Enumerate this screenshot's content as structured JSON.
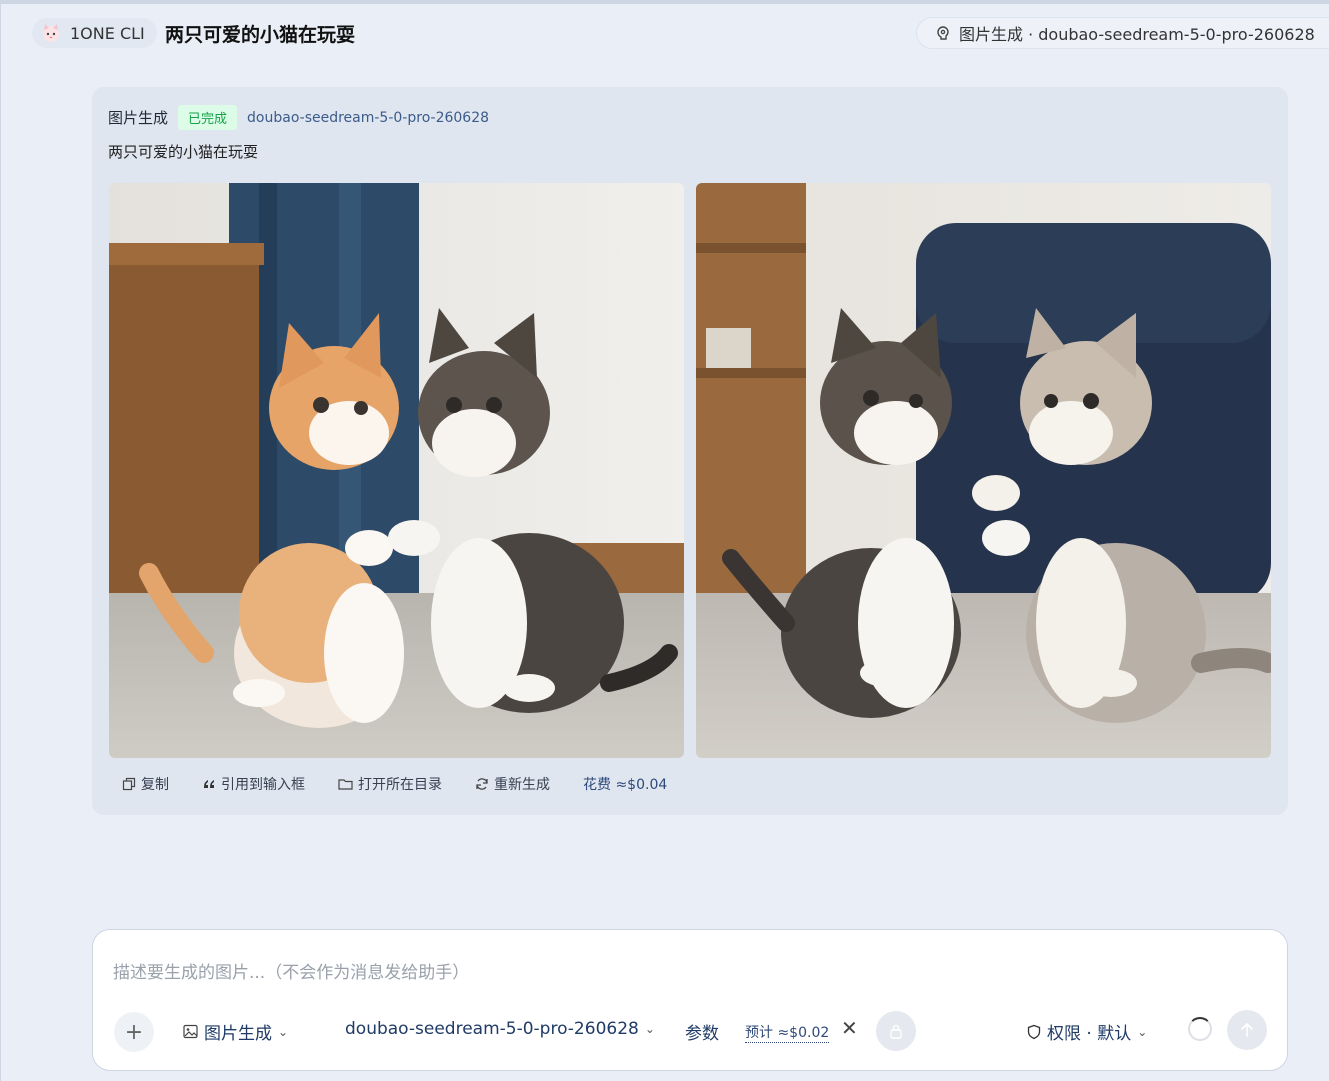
{
  "header": {
    "app_name": "1ONE CLI",
    "conversation_title": "两只可爱的小猫在玩耍",
    "mode_model_label": "图片生成 · doubao-seedream-5-0-pro-260628"
  },
  "card": {
    "type_label": "图片生成",
    "status": "已完成",
    "model": "doubao-seedream-5-0-pro-260628",
    "prompt": "两只可爱的小猫在玩耍",
    "actions": {
      "copy": "复制",
      "quote": "引用到输入框",
      "open_dir": "打开所在目录",
      "regenerate": "重新生成",
      "cost": "花费 ≈$0.04"
    }
  },
  "composer": {
    "placeholder": "描述要生成的图片...（不会作为消息发给助手）",
    "plus": "+",
    "mode": "图片生成",
    "model": "doubao-seedream-5-0-pro-260628",
    "params": "参数",
    "estimate": "预计 ≈$0.02",
    "clear": "✕",
    "permission": "权限 · 默认"
  },
  "colors": {
    "background": "#e9eef7",
    "card": "#dfe6f0",
    "accent": "#1f3b66",
    "success": "#16a34a"
  },
  "icons": [
    "cat-logo-icon",
    "model-icon",
    "copy-icon",
    "quote-icon",
    "folder-icon",
    "refresh-icon",
    "image-icon",
    "chevron-down-icon",
    "shield-icon",
    "lock-icon",
    "send-icon",
    "spinner-icon"
  ]
}
